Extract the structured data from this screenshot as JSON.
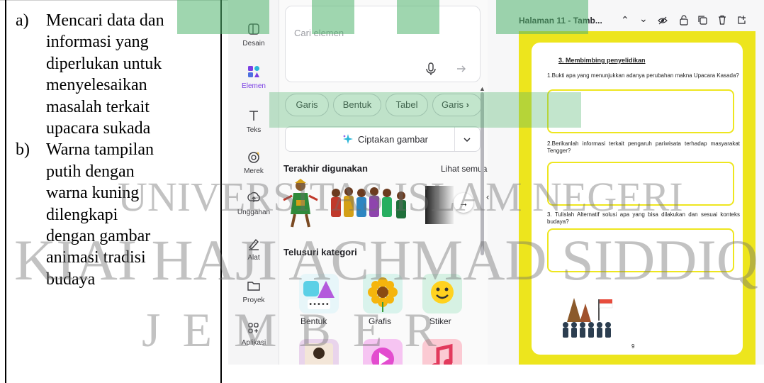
{
  "left_column": {
    "items": [
      {
        "marker": "a)",
        "lines": [
          "Mencari data dan",
          "informasi yang",
          "diperlukan untuk",
          "menyelesaikan",
          "masalah terkait",
          "upacara sukada"
        ]
      },
      {
        "marker": "b)",
        "lines": [
          "Warna tampilan",
          "putih dengan",
          "warna kuning",
          "dilengkapi",
          "dengan gambar",
          "animasi tradisi",
          "budaya"
        ]
      }
    ]
  },
  "rail": {
    "items": [
      {
        "label": "Desain",
        "icon": "layout-icon"
      },
      {
        "label": "Elemen",
        "icon": "elements-icon"
      },
      {
        "label": "Teks",
        "icon": "text-icon"
      },
      {
        "label": "Merek",
        "icon": "brand-icon"
      },
      {
        "label": "Unggahan",
        "icon": "upload-icon"
      },
      {
        "label": "Alat",
        "icon": "draw-icon"
      },
      {
        "label": "Proyek",
        "icon": "folder-icon"
      },
      {
        "label": "Aplikasi",
        "icon": "apps-icon"
      }
    ]
  },
  "panel": {
    "search_placeholder": "Cari elemen",
    "chips": [
      "Garis",
      "Bentuk",
      "Tabel",
      "Garis"
    ],
    "generate_label": "Ciptakan gambar",
    "recent_title": "Terakhir digunakan",
    "see_all": "Lihat semua",
    "categories_title": "Telusuri kategori",
    "categories": [
      {
        "label": "Bentuk",
        "color": "#5bd0e6"
      },
      {
        "label": "Grafis",
        "color": "#7ad7c0"
      },
      {
        "label": "Stiker",
        "color": "#58c99a"
      }
    ],
    "more_categories": [
      "#e9d4ec",
      "#f6a8f0",
      "#f7b5c5"
    ]
  },
  "doc": {
    "page_title": "Halaman 11 - Tamb...",
    "heading": "3. Membimbing penyelidikan",
    "questions": [
      "1.Bukti apa yang menunjukkan adanya perubahan makna Upacara Kasada?",
      "2.Berikanlah informasi terkait pengaruh pariwisata terhadap masyarakat Tengger?",
      "3. Tulislah Alternatif solusi apa yang bisa dilakukan dan sesuai konteks budaya?"
    ],
    "page_number": "9",
    "accent": "#ede51d"
  },
  "watermark": {
    "line1": "UNIVERSITAS ISLAM NEGERI",
    "line2": "KIAI HAJI ACHMAD SIDDIQ",
    "line3": "J E M B E R"
  }
}
